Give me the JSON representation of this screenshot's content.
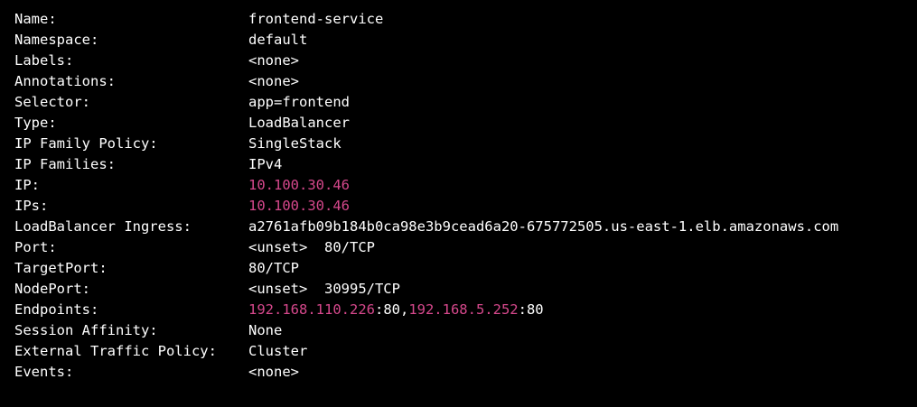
{
  "colors": {
    "background": "#000000",
    "text": "#ffffff",
    "ip_highlight": "#d6488c"
  },
  "rows": [
    {
      "key": "Name:",
      "value": "frontend-service"
    },
    {
      "key": "Namespace:",
      "value": "default"
    },
    {
      "key": "Labels:",
      "value": "<none>"
    },
    {
      "key": "Annotations:",
      "value": "<none>"
    },
    {
      "key": "Selector:",
      "value": "app=frontend"
    },
    {
      "key": "Type:",
      "value": "LoadBalancer"
    },
    {
      "key": "IP Family Policy:",
      "value": "SingleStack"
    },
    {
      "key": "IP Families:",
      "value": "IPv4"
    },
    {
      "key": "IP:",
      "value": "10.100.30.46"
    },
    {
      "key": "IPs:",
      "value": "10.100.30.46"
    },
    {
      "key": "LoadBalancer Ingress:",
      "value": "a2761afb09b184b0ca98e3b9cead6a20-675772505.us-east-1.elb.amazonaws.com"
    },
    {
      "key": "Port:",
      "value": "<unset>  80/TCP"
    },
    {
      "key": "TargetPort:",
      "value": "80/TCP"
    },
    {
      "key": "NodePort:",
      "value": "<unset>  30995/TCP"
    },
    {
      "key": "Endpoints:",
      "endpoint1_ip": "192.168.110.226",
      "endpoint1_port": ":80,",
      "endpoint2_ip": "192.168.5.252",
      "endpoint2_port": ":80"
    },
    {
      "key": "Session Affinity:",
      "value": "None"
    },
    {
      "key": "External Traffic Policy:",
      "value": "Cluster"
    },
    {
      "key": "Events:",
      "value": "<none>"
    }
  ]
}
